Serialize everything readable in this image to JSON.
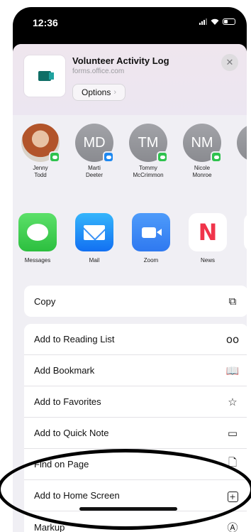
{
  "status_bar": {
    "time": "12:36"
  },
  "share_header": {
    "title": "Volunteer Activity Log",
    "subtitle": "forms.office.com",
    "options_label": "Options",
    "options_chevron": "›",
    "close_glyph": "✕"
  },
  "people": [
    {
      "initials": "",
      "name_line1": "Jenny",
      "name_line2": "Todd",
      "badge": "message-icon"
    },
    {
      "initials": "MD",
      "name_line1": "Marti",
      "name_line2": "Deeter",
      "badge": "mail-icon"
    },
    {
      "initials": "TM",
      "name_line1": "Tommy",
      "name_line2": "McCrimmon",
      "badge": "message-icon"
    },
    {
      "initials": "NM",
      "name_line1": "Nicole",
      "name_line2": "Monroe",
      "badge": "message-icon"
    }
  ],
  "apps": [
    {
      "label": "Messages",
      "icon": "messages-icon"
    },
    {
      "label": "Mail",
      "icon": "mail-icon"
    },
    {
      "label": "Zoom",
      "icon": "zoom-icon"
    },
    {
      "label": "News",
      "icon": "news-icon"
    }
  ],
  "actions_group1": [
    {
      "label": "Copy",
      "icon": "copy-icon",
      "glyph": "⧉"
    }
  ],
  "actions_group2": [
    {
      "label": "Add to Reading List",
      "icon": "glasses-icon",
      "glyph": "oo"
    },
    {
      "label": "Add Bookmark",
      "icon": "book-icon",
      "glyph": "📖"
    },
    {
      "label": "Add to Favorites",
      "icon": "star-icon",
      "glyph": "☆"
    },
    {
      "label": "Add to Quick Note",
      "icon": "quick-note-icon",
      "glyph": "▭"
    },
    {
      "label": "Find on Page",
      "icon": "find-on-page-icon",
      "glyph": "🗋"
    },
    {
      "label": "Add to Home Screen",
      "icon": "add-square-icon",
      "glyph": "+"
    },
    {
      "label": "Markup",
      "icon": "markup-icon",
      "glyph": "Ⓐ"
    }
  ],
  "colors": {
    "messages_green": "#2cbf3f",
    "mail_blue": "#1270f2",
    "zoom_blue": "#2f79f0",
    "news_red": "#f0344a",
    "sheet_background": "#f0eff4"
  }
}
